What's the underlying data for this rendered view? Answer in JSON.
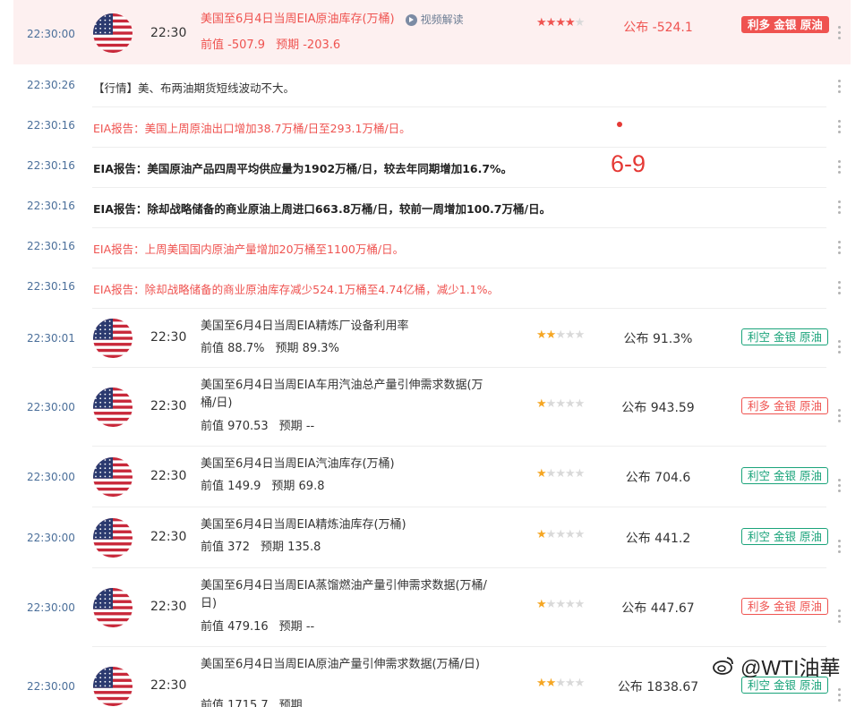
{
  "data_rows_common": {
    "prev_label": "前值",
    "forecast_label": "预期",
    "publish_label": "公布"
  },
  "highlight": {
    "time": "22:30:00",
    "hour": "22:30",
    "title": "美国至6月4日当周EIA原油库存(万桶)",
    "video_label": "视频解读",
    "prev": "-507.9",
    "forecast": "-203.6",
    "stars": 4,
    "actual": "-524.1",
    "tag": "利多 金银 原油"
  },
  "news": [
    {
      "time": "22:30:26",
      "style": "plain",
      "text": "【行情】美、布两油期货短线波动不大。"
    },
    {
      "time": "22:30:16",
      "style": "red",
      "text": "EIA报告：美国上周原油出口增加38.7万桶/日至293.1万桶/日。"
    },
    {
      "time": "22:30:16",
      "style": "bold",
      "text": "EIA报告：美国原油产品四周平均供应量为1902万桶/日，较去年同期增加16.7%。"
    },
    {
      "time": "22:30:16",
      "style": "bold",
      "text": "EIA报告：除却战略储备的商业原油上周进口663.8万桶/日，较前一周增加100.7万桶/日。"
    },
    {
      "time": "22:30:16",
      "style": "red",
      "text": "EIA报告：上周美国国内原油产量增加20万桶至1100万桶/日。"
    },
    {
      "time": "22:30:16",
      "style": "red",
      "text": "EIA报告：除却战略储备的商业原油库存减少524.1万桶至4.74亿桶，减少1.1%。"
    }
  ],
  "rows": [
    {
      "time": "22:30:01",
      "hour": "22:30",
      "title": "美国至6月4日当周EIA精炼厂设备利用率",
      "prev": "88.7%",
      "forecast": "89.3%",
      "stars": 2,
      "actual": "91.3%",
      "tag": "利空 金银 原油",
      "tag_type": "bad"
    },
    {
      "time": "22:30:00",
      "hour": "22:30",
      "title": "美国至6月4日当周EIA车用汽油总产量引伸需求数据(万桶/日)",
      "prev": "970.53",
      "forecast": "--",
      "stars": 1,
      "actual": "943.59",
      "tag": "利多 金银 原油",
      "tag_type": "good"
    },
    {
      "time": "22:30:00",
      "hour": "22:30",
      "title": "美国至6月4日当周EIA汽油库存(万桶)",
      "prev": "149.9",
      "forecast": "69.8",
      "stars": 1,
      "actual": "704.6",
      "tag": "利空 金银 原油",
      "tag_type": "bad"
    },
    {
      "time": "22:30:00",
      "hour": "22:30",
      "title": "美国至6月4日当周EIA精炼油库存(万桶)",
      "prev": "372",
      "forecast": "135.8",
      "stars": 1,
      "actual": "441.2",
      "tag": "利空 金银 原油",
      "tag_type": "bad"
    },
    {
      "time": "22:30:00",
      "hour": "22:30",
      "title": "美国至6月4日当周EIA蒸馏燃油产量引伸需求数据(万桶/日)",
      "prev": "479.16",
      "forecast": "--",
      "stars": 1,
      "actual": "447.67",
      "tag": "利多 金银 原油",
      "tag_type": "good"
    },
    {
      "time": "22:30:00",
      "hour": "22:30",
      "title": "美国至6月4日当周EIA原油产量引伸需求数据(万桶/日)",
      "prev": "1715.7",
      "forecast": "",
      "stars": 2,
      "actual": "1838.67",
      "tag": "利空 金银 原油",
      "tag_type": "bad"
    }
  ],
  "annotation": {
    "number": "6-9"
  },
  "watermark": {
    "text": "@WTI油華"
  },
  "colors": {
    "bullish": "#ef5350",
    "bearish": "#1aa37a",
    "star": "#f5a623",
    "highlight_bg": "#fdf0f0"
  }
}
